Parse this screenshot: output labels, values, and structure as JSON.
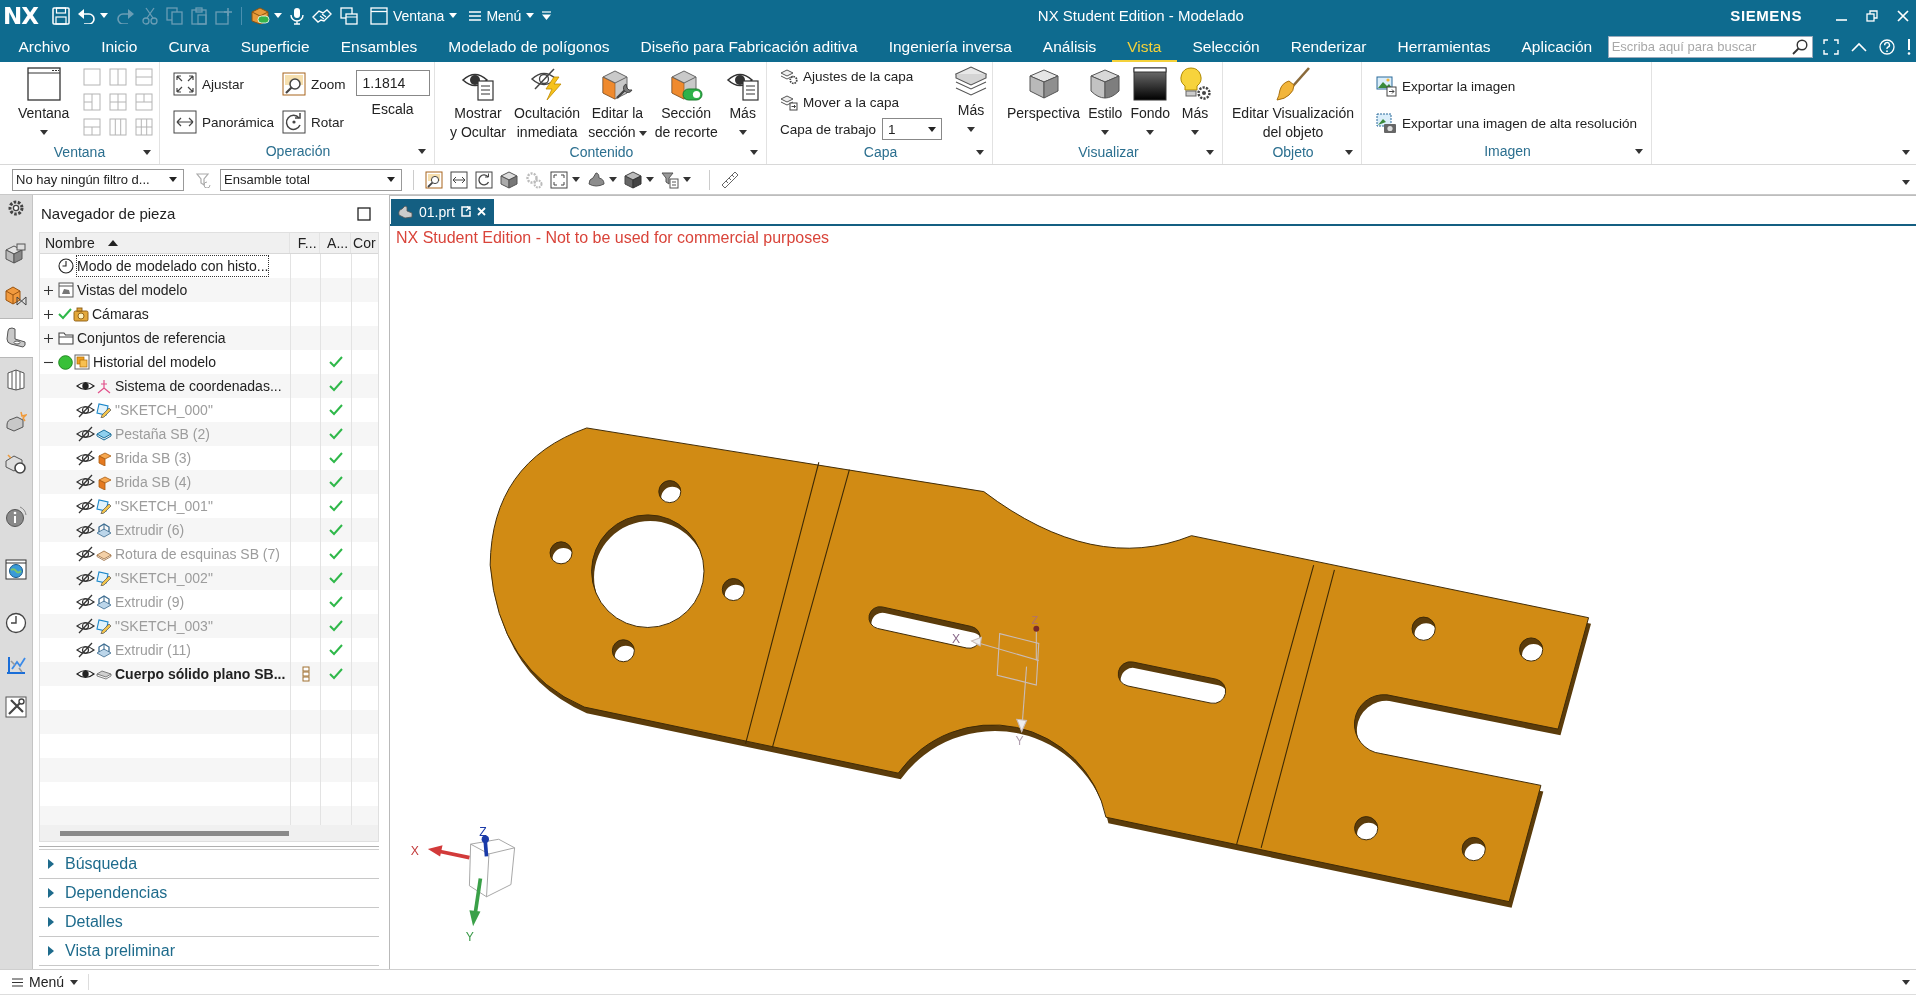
{
  "title_bar": {
    "logo": "NX",
    "window_button": "Ventana",
    "menu_button": "Menú",
    "title": "NX Student Edition - Modelado",
    "brand": "SIEMENS"
  },
  "menu_tabs": [
    {
      "label": "Archivo",
      "selected": false
    },
    {
      "label": "Inicio",
      "selected": false
    },
    {
      "label": "Curva",
      "selected": false
    },
    {
      "label": "Superficie",
      "selected": false
    },
    {
      "label": "Ensambles",
      "selected": false
    },
    {
      "label": "Modelado de polígonos",
      "selected": false
    },
    {
      "label": "Diseño para Fabricación aditiva",
      "selected": false
    },
    {
      "label": "Ingeniería inversa",
      "selected": false
    },
    {
      "label": "Análisis",
      "selected": false
    },
    {
      "label": "Vista",
      "selected": true
    },
    {
      "label": "Selección",
      "selected": false
    },
    {
      "label": "Renderizar",
      "selected": false
    },
    {
      "label": "Herramientas",
      "selected": false
    },
    {
      "label": "Aplicación",
      "selected": false
    }
  ],
  "search": {
    "placeholder": "Escriba aquí para buscar"
  },
  "ribbon": [
    {
      "label": "Ventana",
      "items": [
        {
          "kind": "large",
          "label": "Ventana",
          "dropdown": true
        },
        {
          "kind": "grid"
        }
      ]
    },
    {
      "label": "Operación",
      "items": [
        {
          "kind": "stack",
          "items": [
            {
              "kind": "small",
              "label": "Ajustar"
            },
            {
              "kind": "small",
              "label": "Panorámica"
            }
          ]
        },
        {
          "kind": "stack",
          "items": [
            {
              "kind": "small",
              "label": "Zoom"
            },
            {
              "kind": "small",
              "label": "Rotar"
            }
          ]
        },
        {
          "kind": "field",
          "label": "Escala",
          "value": "1.1814"
        }
      ]
    },
    {
      "label": "Contenido",
      "items": [
        {
          "kind": "large",
          "label": "Mostrar\ny Ocultar",
          "dropdown": false
        },
        {
          "kind": "large",
          "label": "Ocultación\ninmediata",
          "dropdown": false
        },
        {
          "kind": "large",
          "label": "Editar la\nsección",
          "dropdown": true
        },
        {
          "kind": "large",
          "label": "Sección\nde recorte",
          "dropdown": false
        },
        {
          "kind": "large",
          "label": "Más",
          "dropdown": true
        }
      ]
    },
    {
      "label": "Capa",
      "items": [
        {
          "kind": "stack",
          "items": [
            {
              "kind": "small",
              "label": "Ajustes de la capa"
            },
            {
              "kind": "small",
              "label": "Mover a la capa"
            },
            {
              "kind": "select",
              "label": "Capa de trabajo",
              "value": "1"
            }
          ]
        },
        {
          "kind": "large",
          "label": "Más",
          "dropdown": true
        }
      ]
    },
    {
      "label": "Visualizar",
      "items": [
        {
          "kind": "large",
          "label": "Perspectiva",
          "dropdown": false
        },
        {
          "kind": "large",
          "label": "Estilo",
          "dropdown": true
        },
        {
          "kind": "large",
          "label": "Fondo",
          "dropdown": true
        },
        {
          "kind": "large",
          "label": "Más",
          "dropdown": true
        }
      ]
    },
    {
      "label": "Objeto",
      "items": [
        {
          "kind": "large",
          "label": "Editar Visualización\ndel objeto",
          "dropdown": false
        }
      ]
    },
    {
      "label": "Imagen",
      "items": [
        {
          "kind": "stack",
          "items": [
            {
              "kind": "small",
              "label": "Exportar la imagen"
            },
            {
              "kind": "small",
              "label": "Exportar una imagen de alta resolución"
            }
          ]
        }
      ]
    }
  ],
  "selection_bar": {
    "filter": "No hay ningún filtro d...",
    "scope": "Ensamble total"
  },
  "resource_bar": [
    {
      "selected": false
    },
    {
      "selected": false
    },
    {
      "selected": true
    },
    {
      "selected": false
    },
    {
      "selected": false
    },
    {
      "selected": false
    },
    {
      "selected": false
    },
    {
      "selected": false
    },
    {
      "selected": false
    },
    {
      "selected": false
    },
    {
      "selected": false
    }
  ],
  "part_navigator": {
    "title": "Navegador de pieza",
    "columns": [
      "Nombre",
      "F...",
      "A...",
      "Cor"
    ],
    "tree": [
      {
        "name": "Modo de modelado con histo...",
        "kind": "mode",
        "focused": true,
        "checked": false,
        "column_a_check": false
      },
      {
        "name": "Vistas del modelo",
        "kind": "views",
        "focused": false,
        "checked": false,
        "column_a_check": false,
        "expanded": false
      },
      {
        "name": "Cámaras",
        "kind": "cameras",
        "focused": false,
        "checked": true,
        "column_a_check": false,
        "expanded": false
      },
      {
        "name": "Conjuntos de referencia",
        "kind": "sets",
        "focused": false,
        "checked": false,
        "column_a_check": false,
        "expanded": false
      },
      {
        "name": "Historial del modelo",
        "kind": "history",
        "focused": false,
        "checked": false,
        "column_a_check": true,
        "expanded": true,
        "children": [
          {
            "name": "Sistema de coordenadas...",
            "kind": "csys",
            "visible": true,
            "current": false,
            "column_f_icon": false,
            "column_a_check": true
          },
          {
            "name": "\"SKETCH_000\"",
            "kind": "sketch",
            "visible": false,
            "current": false,
            "column_f_icon": false,
            "column_a_check": true
          },
          {
            "name": "Pestaña SB (2)",
            "kind": "tab",
            "visible": false,
            "current": false,
            "column_f_icon": false,
            "column_a_check": true
          },
          {
            "name": "Brida SB (3)",
            "kind": "flange",
            "visible": false,
            "current": false,
            "column_f_icon": false,
            "column_a_check": true
          },
          {
            "name": "Brida SB (4)",
            "kind": "flange",
            "visible": false,
            "current": false,
            "column_f_icon": false,
            "column_a_check": true
          },
          {
            "name": "\"SKETCH_001\"",
            "kind": "sketch",
            "visible": false,
            "current": false,
            "column_f_icon": false,
            "column_a_check": true
          },
          {
            "name": "Extrudir (6)",
            "kind": "extrude",
            "visible": false,
            "current": false,
            "column_f_icon": false,
            "column_a_check": true
          },
          {
            "name": "Rotura de esquinas SB (7)",
            "kind": "corner",
            "visible": false,
            "current": false,
            "column_f_icon": false,
            "column_a_check": true
          },
          {
            "name": "\"SKETCH_002\"",
            "kind": "sketch",
            "visible": false,
            "current": false,
            "column_f_icon": false,
            "column_a_check": true
          },
          {
            "name": "Extrudir (9)",
            "kind": "extrude",
            "visible": false,
            "current": false,
            "column_f_icon": false,
            "column_a_check": true
          },
          {
            "name": "\"SKETCH_003\"",
            "kind": "sketch",
            "visible": false,
            "current": false,
            "column_f_icon": false,
            "column_a_check": true
          },
          {
            "name": "Extrudir (11)",
            "kind": "extrude",
            "visible": false,
            "current": false,
            "column_f_icon": false,
            "column_a_check": true
          },
          {
            "name": "Cuerpo sólido plano SB...",
            "kind": "body",
            "visible": true,
            "current": true,
            "column_f_icon": true,
            "column_a_check": true
          }
        ]
      }
    ],
    "panels": [
      {
        "label": "Búsqueda",
        "expanded": false
      },
      {
        "label": "Dependencias",
        "expanded": false
      },
      {
        "label": "Detalles",
        "expanded": false
      },
      {
        "label": "Vista preliminar",
        "expanded": false
      }
    ]
  },
  "document_tabs": [
    {
      "label": "01.prt",
      "selected": true
    }
  ],
  "viewport": {
    "notice": "NX Student Edition - Not to be used for commercial purposes",
    "work_csys": {
      "x_label": "X",
      "y_label": "Y",
      "z_label": "Z"
    },
    "view_triad": {
      "x_label": "X",
      "y_label": "Y",
      "z_label": "Z"
    }
  },
  "bottom_bar": {
    "menu_button": "Menú"
  }
}
